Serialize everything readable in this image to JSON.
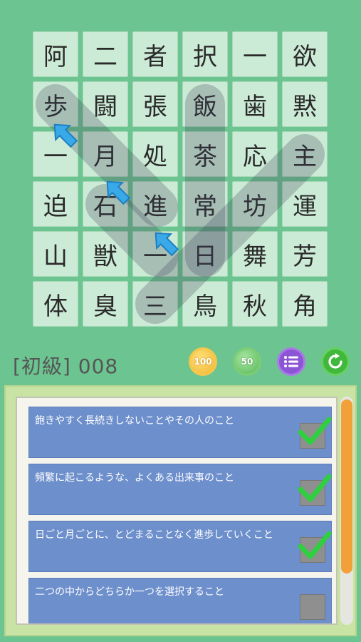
{
  "board": {
    "rows": [
      [
        "阿",
        "二",
        "者",
        "択",
        "一",
        "欲"
      ],
      [
        "歩",
        "闘",
        "張",
        "飯",
        "歯",
        "黙"
      ],
      [
        "一",
        "月",
        "処",
        "茶",
        "応",
        "主"
      ],
      [
        "迫",
        "石",
        "進",
        "常",
        "坊",
        "運"
      ],
      [
        "山",
        "獣",
        "一",
        "日",
        "舞",
        "芳"
      ],
      [
        "体",
        "臭",
        "三",
        "鳥",
        "秋",
        "角"
      ]
    ]
  },
  "header": {
    "level": "[初級] 008",
    "buttons": [
      {
        "label": "100",
        "icon": "medal-100-icon"
      },
      {
        "label": "50",
        "icon": "medal-50-icon"
      },
      {
        "label": "",
        "icon": "list-icon"
      },
      {
        "label": "",
        "icon": "restart-icon"
      }
    ]
  },
  "clues": [
    {
      "text": "飽きやすく長続きしないことやその人のこと",
      "checked": true
    },
    {
      "text": "頻繁に起こるような、よくある出来事のこと",
      "checked": true
    },
    {
      "text": "日ごと月ごとに、とどまることなく進歩していくこと",
      "checked": true
    },
    {
      "text": "二つの中からどちらか一つを選択すること",
      "checked": false
    }
  ],
  "colors": {
    "background": "#6cc491",
    "cell": "#ccebd6",
    "clue": "#6d8fcc",
    "scroll_thumb": "#f2a03a"
  }
}
